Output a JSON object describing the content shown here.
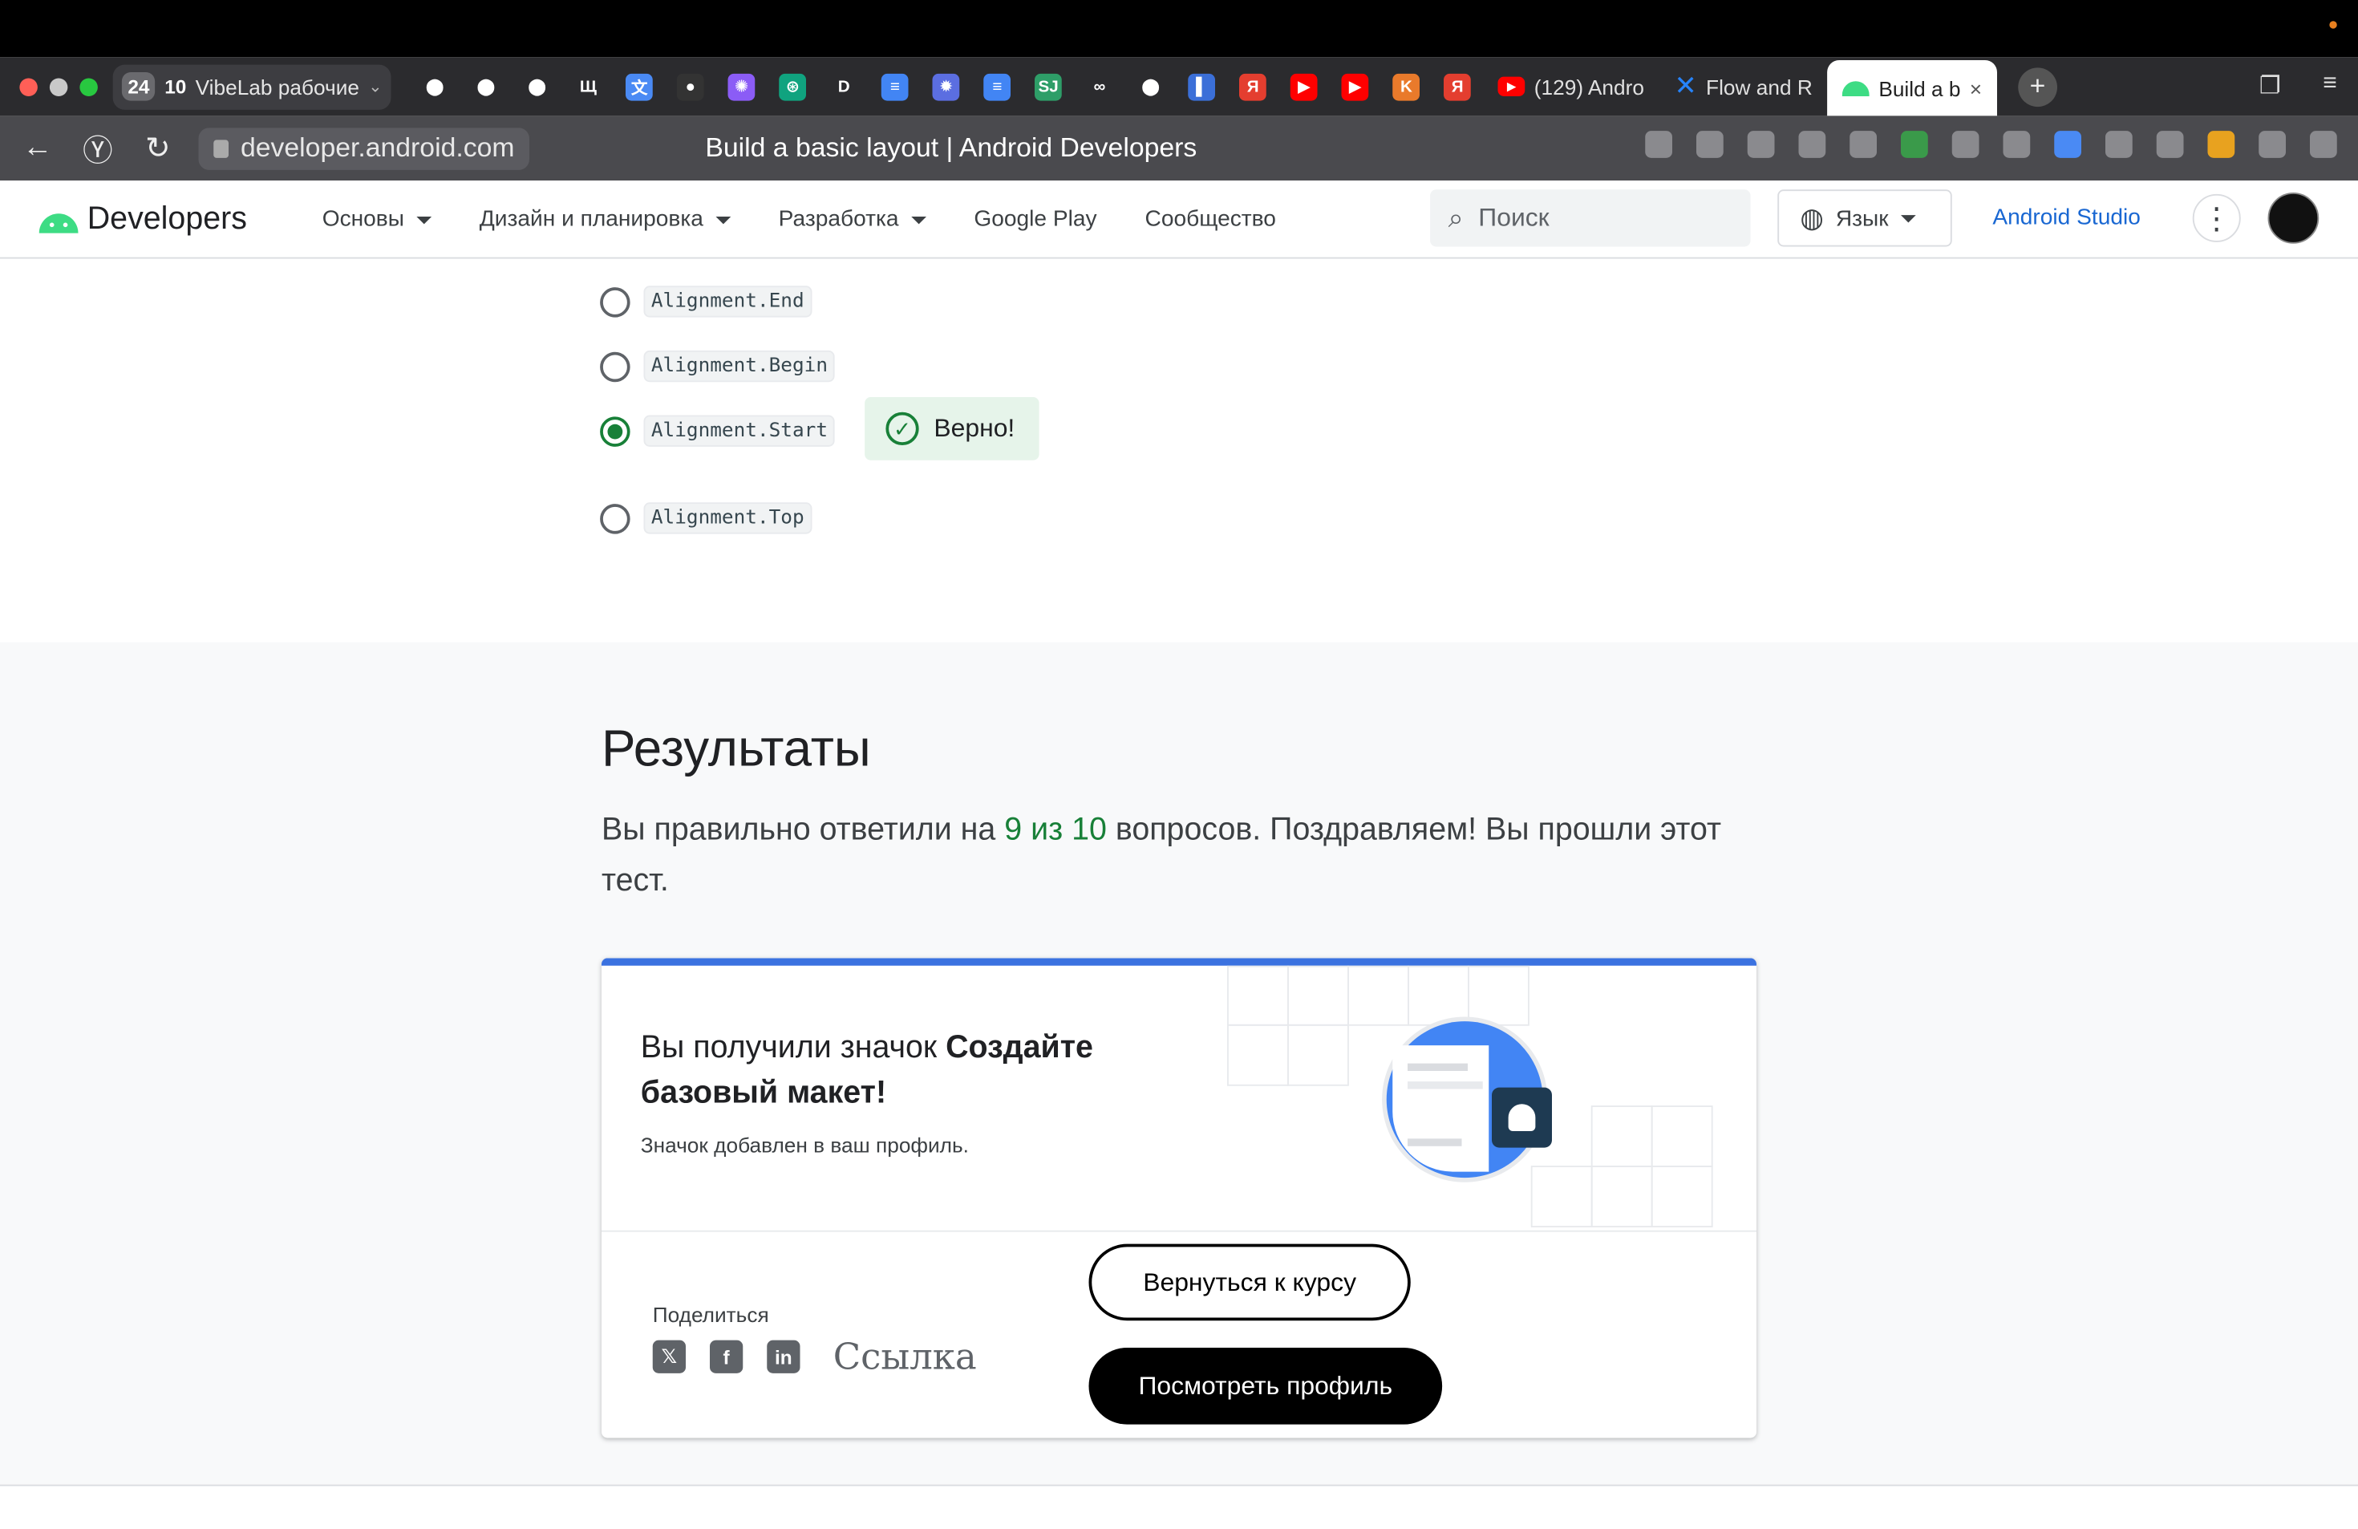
{
  "browser": {
    "tab_group_count": "24",
    "tab_group_subcount": "10",
    "tab_group_label": "VibeLab рабочие",
    "tabs": [
      {
        "icon": "github-icon",
        "color": "#ffffff"
      },
      {
        "icon": "github-icon",
        "color": "#ffffff"
      },
      {
        "icon": "github-icon",
        "color": "#ffffff"
      },
      {
        "icon": "lt-icon",
        "color": "#ffffff"
      },
      {
        "icon": "translate-icon",
        "color": "#4a8af4"
      },
      {
        "icon": "dot-icon",
        "color": "#333333"
      },
      {
        "icon": "purple-star-icon",
        "color": "#8b5cf6"
      },
      {
        "icon": "chatgpt-icon",
        "color": "#10a37f"
      },
      {
        "icon": "d-icon",
        "color": "#ffffff"
      },
      {
        "icon": "docs-icon",
        "color": "#4285f4"
      },
      {
        "icon": "gear-blue-icon",
        "color": "#5b6ee1"
      },
      {
        "icon": "docs-icon",
        "color": "#4285f4"
      },
      {
        "icon": "sj-icon",
        "color": "#2e9e68"
      },
      {
        "icon": "link-icon",
        "color": "#ffffff"
      },
      {
        "icon": "github-icon",
        "color": "#ffffff"
      },
      {
        "icon": "blue-square-icon",
        "color": "#3b6fd8"
      },
      {
        "icon": "yandex-icon",
        "color": "#e43e2f"
      },
      {
        "icon": "youtube-icon",
        "color": "#ff0000"
      },
      {
        "icon": "youtube-icon",
        "color": "#ff0000"
      },
      {
        "icon": "kotlin-icon",
        "color": "#e97a2b"
      },
      {
        "icon": "yandex-icon",
        "color": "#e43e2f"
      }
    ],
    "wide_tabs": [
      {
        "label": "(129) Andro",
        "icon": "youtube-icon"
      },
      {
        "label": "Flow and R",
        "icon": "confluence-icon"
      },
      {
        "label": "Build a b",
        "icon": "android-icon",
        "active": true
      }
    ],
    "url": "developer.android.com",
    "page_title": "Build a basic layout  |  Android Developers"
  },
  "site": {
    "logo_text": "Developers",
    "menu": [
      {
        "label": "Основы",
        "caret": true
      },
      {
        "label": "Дизайн и планировка",
        "caret": true
      },
      {
        "label": "Разработка",
        "caret": true
      },
      {
        "label": "Google Play",
        "caret": false
      },
      {
        "label": "Сообщество",
        "caret": false
      }
    ],
    "search_placeholder": "Поиск",
    "language_label": "Язык",
    "studio_link": "Android Studio"
  },
  "quiz": {
    "options": [
      {
        "label": "Alignment.End",
        "selected": false
      },
      {
        "label": "Alignment.Begin",
        "selected": false
      },
      {
        "label": "Alignment.Start",
        "selected": true
      },
      {
        "label": "Alignment.Top",
        "selected": false
      }
    ],
    "feedback": "Верно!"
  },
  "results": {
    "heading": "Результаты",
    "text_before": "Вы правильно ответили на ",
    "score": "9 из 10",
    "text_after": " вопросов. Поздравляем! Вы прошли этот тест.",
    "badge_prefix": "Вы получили значок ",
    "badge_name": "Создайте базовый макет!",
    "badge_added": "Значок добавлен в ваш профиль.",
    "share_label": "Поделиться",
    "share_link": "Ссылка",
    "back_button": "Вернуться к курсу",
    "profile_button": "Посмотреть профиль"
  },
  "colors": {
    "accent_green": "#188038",
    "card_bar": "#3b72e0",
    "link_blue": "#1967d2"
  }
}
